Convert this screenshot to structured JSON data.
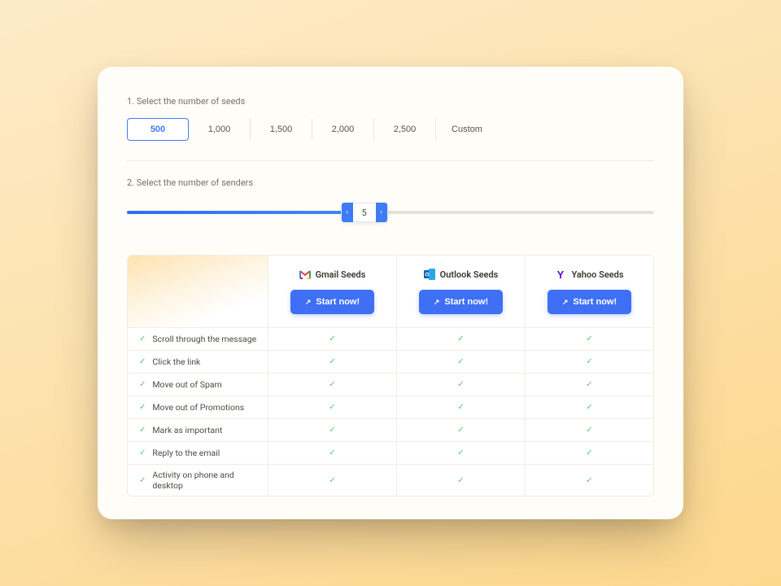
{
  "step1": {
    "label": "1. Select the number of seeds",
    "options": [
      "500",
      "1,000",
      "1,500",
      "2,000",
      "2,500",
      "Custom"
    ],
    "selected_index": 0
  },
  "step2": {
    "label": "2. Select the number of senders",
    "value": "5",
    "percent": 45
  },
  "table": {
    "providers": [
      {
        "label": "Gmail Seeds",
        "button": "Start now!",
        "icon": "gmail"
      },
      {
        "label": "Outlook Seeds",
        "button": "Start now!",
        "icon": "outlook"
      },
      {
        "label": "Yahoo Seeds",
        "button": "Start now!",
        "icon": "yahoo"
      }
    ],
    "features": [
      "Scroll through the message",
      "Click the link",
      "Move out of Spam",
      "Move out of Promotions",
      "Mark as important",
      "Reply to the email",
      "Activity on phone and desktop"
    ]
  }
}
